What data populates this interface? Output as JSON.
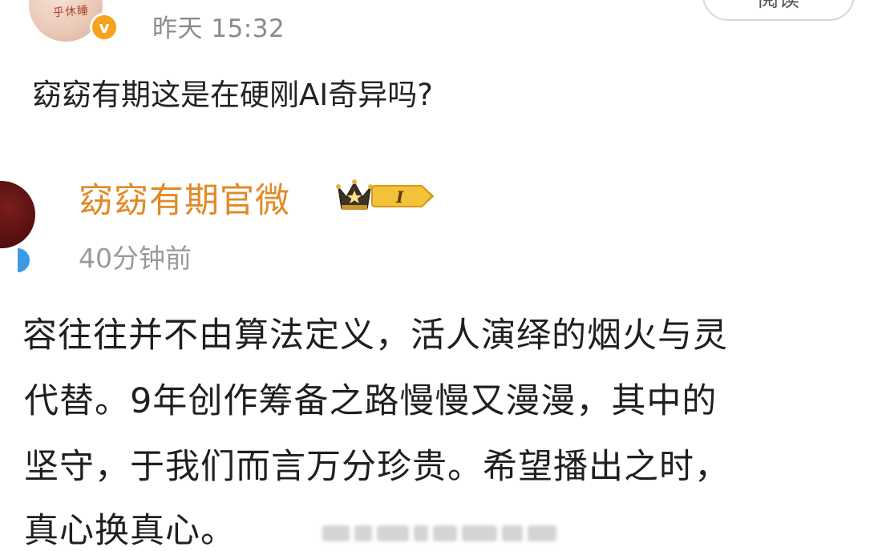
{
  "post": {
    "avatar_scribble": "乎休睡",
    "verified_icon": "v",
    "time": "昨天 15:32",
    "read_label": "阅读",
    "text": "窈窈有期这是在硬刚AI奇异吗?"
  },
  "quoted": {
    "name": "窈窈有期官微",
    "level_badge": "I",
    "time": "40分钟前",
    "lines": [
      "容往往并不由算法定义，活人演绎的烟火与灵",
      "代替。9年创作筹备之路慢慢又漫漫，其中的",
      "坚守，于我们而言万分珍贵。希望播出之时，",
      "真心换真心。"
    ]
  },
  "colors": {
    "name": "#e08a28",
    "verified_orange": "#f6a21c",
    "verified_blue": "#3c9be8"
  }
}
